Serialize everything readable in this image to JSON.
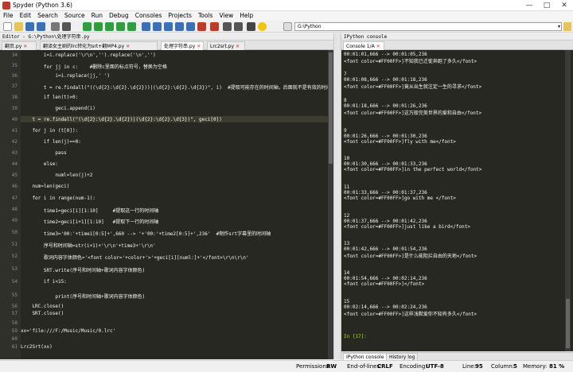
{
  "window": {
    "title": "Spyder (Python 3.6)"
  },
  "menu": [
    "File",
    "Edit",
    "Search",
    "Source",
    "Run",
    "Debug",
    "Consoles",
    "Projects",
    "Tools",
    "View",
    "Help"
  ],
  "toolbar": {
    "path": "G:\\Python"
  },
  "editor": {
    "header": "Editor - G:\\Python\\处理字符串.py",
    "tabs": [
      "翻页.py",
      "翻译女主剧的lrc转化为srt+翻MP4.py",
      "处理字符串.py",
      "Lrc2srt.py"
    ],
    "lines": [
      {
        "n": "34",
        "t": "        i=i.replace('\\r\\n','').replace('\\n','')"
      },
      {
        "n": "35",
        "t": "        for jj in c:    #删除c里面的标点符号，替换为空格"
      },
      {
        "n": "36",
        "t": "            i=i.replace(jj,' ')"
      },
      {
        "n": "37",
        "t": "        t = re.findall(\"((\\d{2}:\\d{2}.\\d{2}))|(\\d{2}:\\d{2}.\\d{3})\", i)  #提取可能存在的时间轴，后面就不是有效的时间"
      },
      {
        "n": "38",
        "t": "        if len(t)>0:"
      },
      {
        "n": "39",
        "t": "            geci.append(i)"
      },
      {
        "n": "40",
        "t": "    t = re.findall(\"(\\d{2}:\\d{2}.\\d{2})|(\\d{2}:\\d{2}.\\d{3})\", geci[0])"
      },
      {
        "n": "41",
        "t": "    for j in (t[0]):"
      },
      {
        "n": "42",
        "t": "        if len(j)==0:"
      },
      {
        "n": "43",
        "t": "            pass"
      },
      {
        "n": "44",
        "t": "        else:"
      },
      {
        "n": "45",
        "t": "            numl=len(j)+2"
      },
      {
        "n": "46",
        "t": "    num=len(geci)"
      },
      {
        "n": "47",
        "t": "    for i in range(num-1):"
      },
      {
        "n": "48",
        "t": "        time1=geci[i][1:10]     #提取这一行的时间轴"
      },
      {
        "n": "49",
        "t": "        time2=geci[i+1][1:10]   #提取下一行的时间轴"
      },
      {
        "n": "50",
        "t": "        time3='00:'+time1[0:5]+',660 --> '+'00:'+time2[0:5]+',236'  #制作srt字幕里的时间轴"
      },
      {
        "n": "51",
        "t": "        序号和时间轴=str(i+1)+'\\r\\n'+time3+'\\r\\n'"
      },
      {
        "n": "52",
        "t": "        歌词内容字体颜色='<font color='+color+'>'+geci[i][numl:]+'</font>\\r\\n\\r\\n'"
      },
      {
        "n": "53",
        "t": "        SRT.write(序号和时间轴+歌词内容字体颜色)"
      },
      {
        "n": "54",
        "t": "        if i<15:"
      },
      {
        "n": "55",
        "t": "            print(序号和时间轴+歌词内容字体颜色)"
      },
      {
        "n": "56",
        "t": "    LRC.close()"
      },
      {
        "n": "57",
        "t": "    SRT.close()"
      },
      {
        "n": "58",
        "t": ""
      },
      {
        "n": "59",
        "t": "xx='file:///F:/Music/Music/0.lrc'"
      },
      {
        "n": "60",
        "t": ""
      },
      {
        "n": "61",
        "t": "Lrc2Srt(xx)"
      }
    ]
  },
  "console": {
    "header": "IPython console",
    "tab": "Console 1/A",
    "entries": [
      {
        "idx": "",
        "time": "00:01:01,666 --> 00:01:05,236",
        "text": "<font color=#FF00FF>]不知我已迁徙奔跑了多久</font>"
      },
      {
        "idx": "7",
        "time": "00:01:08,666 --> 00:01:18,236",
        "text": "<font color=#FF00FF>]竟从出生就注定一生的寻求</font>"
      },
      {
        "idx": "8",
        "time": "00:01:18,666 --> 00:01:26,236",
        "text": "<font color=#FF00FF>]这万般完美世界的爱和自由</font>"
      },
      {
        "idx": "9",
        "time": "00:01:26,666 --> 00:01:30,236",
        "text": "<font color=#FF00FF>]fly with me</font>"
      },
      {
        "idx": "10",
        "time": "00:01:30,666 --> 00:01:33,236",
        "text": "<font color=#FF00FF>]in the perfect world</font>"
      },
      {
        "idx": "11",
        "time": "00:01:33,666 --> 00:01:37,236",
        "text": "<font color=#FF00FF>]go with me </font>"
      },
      {
        "idx": "12",
        "time": "00:01:37,666 --> 00:01:42,236",
        "text": "<font color=#FF00FF>]just like a bird</font>"
      },
      {
        "idx": "13",
        "time": "00:01:42,666 --> 00:01:54,236",
        "text": "<font color=#FF00FF>]是什么能阻拦自由的天地</font>"
      },
      {
        "idx": "14",
        "time": "00:01:54,666 --> 00:02:14,236",
        "text": "<font color=#FF00FF>]</font>"
      },
      {
        "idx": "15",
        "time": "00:02:14,666 --> 00:02:24,236",
        "text": "<font color=#FF00FF>]这样浅默爱你不知有多久</font>"
      }
    ],
    "prompt": "In [17]: ",
    "bottom_tabs": [
      "IPython console",
      "History log"
    ]
  },
  "status": {
    "permissions_label": "Permissions:",
    "permissions": "RW",
    "eol_label": "End-of-lines:",
    "eol": "CRLF",
    "encoding_label": "Encoding:",
    "encoding": "UTF-8",
    "line_label": "Line:",
    "line": "95",
    "column_label": "Column:",
    "column": "5",
    "memory_label": "Memory:",
    "memory": "81 %"
  }
}
